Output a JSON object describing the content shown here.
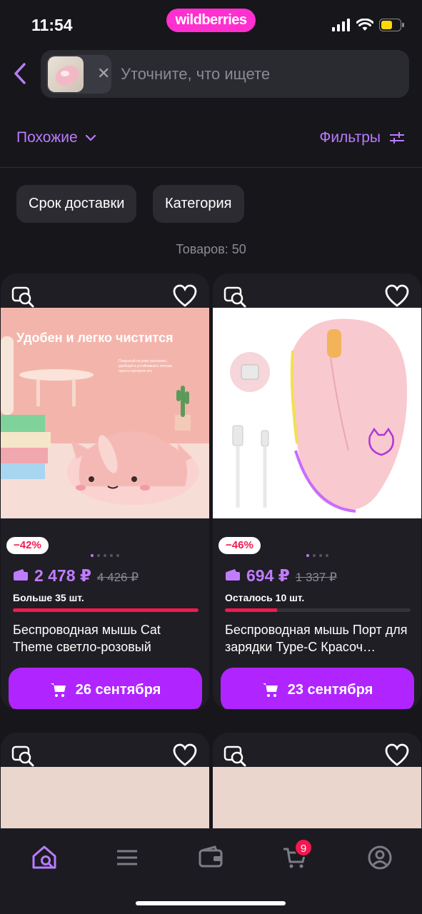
{
  "status_bar": {
    "time": "11:54",
    "brand": "wildberries"
  },
  "search": {
    "placeholder": "Уточните, что ищете"
  },
  "toolbar": {
    "similar_label": "Похожие",
    "filters_label": "Фильтры"
  },
  "chips": [
    "Срок доставки",
    "Категория"
  ],
  "results_count": "Товаров: 50",
  "products": [
    {
      "discount": "−42%",
      "price": "2 478 ₽",
      "old_price": "4 426 ₽",
      "stock": "Больше 35 шт.",
      "stock_level": 1.0,
      "title": "Беспроводная мышь Cat Theme светло-розовый",
      "delivery": "26 сентября",
      "image_caption": "Удобен и легко чистится",
      "image_small_text": "Покрытый на кожу материал, удобный и устойчивый к пятнам, просто протрите его"
    },
    {
      "discount": "−46%",
      "price": "694 ₽",
      "old_price": "1 337 ₽",
      "stock": "Осталось 10 шт.",
      "stock_level": 0.28,
      "title": "Беспроводная мышь Порт для зарядки Type-C Красоч…",
      "delivery": "23 сентября"
    }
  ],
  "cart_badge": "9",
  "colors": {
    "accent": "#b025ff",
    "accent_text": "#b97cff",
    "brand": "#ff2fd0",
    "sale": "#f3194e"
  }
}
